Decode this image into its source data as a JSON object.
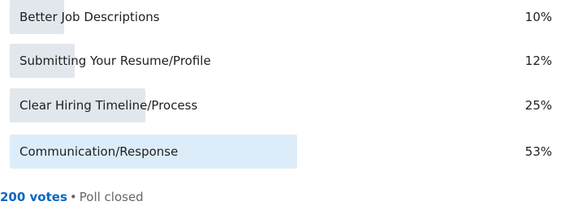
{
  "poll": {
    "options": [
      {
        "label": "Better Job Descriptions",
        "percent_label": "10%",
        "fraction": 0.1,
        "selected": false
      },
      {
        "label": "Submitting Your Resume/Profile",
        "percent_label": "12%",
        "fraction": 0.12,
        "selected": false
      },
      {
        "label": "Clear Hiring Timeline/Process",
        "percent_label": "25%",
        "fraction": 0.25,
        "selected": false
      },
      {
        "label": "Communication/Response",
        "percent_label": "53%",
        "fraction": 0.53,
        "selected": true
      }
    ],
    "votes": "200 votes",
    "separator": "•",
    "status": "Poll closed"
  },
  "colors": {
    "bar": "#e1e7ec",
    "bar_selected": "#dcedf9",
    "votes": "#0a66c2",
    "muted": "#666666"
  }
}
